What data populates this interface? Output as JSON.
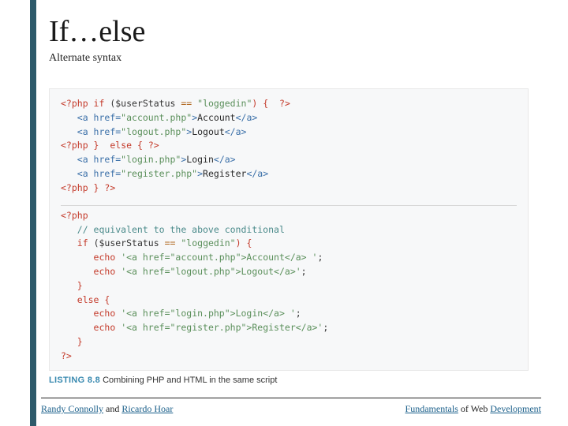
{
  "title": "If…else",
  "subtitle": "Alternate syntax",
  "code": {
    "block1": {
      "l1_a": "<?php ",
      "l1_b": "if",
      "l1_c": " ($userStatus ",
      "l1_d": "==",
      "l1_e": " ",
      "l1_f": "\"loggedin\"",
      "l1_g": ") { ",
      "l1_h": " ?>",
      "l2_a": "   ",
      "l2_b": "<a href=",
      "l2_c": "\"account.php\"",
      "l2_d": ">",
      "l2_e": "Account",
      "l2_f": "</a>",
      "l3_a": "   ",
      "l3_b": "<a href=",
      "l3_c": "\"logout.php\"",
      "l3_d": ">",
      "l3_e": "Logout",
      "l3_f": "</a>",
      "l4_a": "<?php ",
      "l4_b": "}",
      "l4_c": "  ",
      "l4_d": "else",
      "l4_e": " { ",
      "l4_f": "?>",
      "l5_a": "   ",
      "l5_b": "<a href=",
      "l5_c": "\"login.php\"",
      "l5_d": ">",
      "l5_e": "Login",
      "l5_f": "</a>",
      "l6_a": "   ",
      "l6_b": "<a href=",
      "l6_c": "\"register.php\"",
      "l6_d": ">",
      "l6_e": "Register",
      "l6_f": "</a>",
      "l7_a": "<?php ",
      "l7_b": "}",
      "l7_c": " ?>"
    },
    "block2": {
      "l1": "<?php",
      "l2": "   // equivalent to the above conditional",
      "l3_a": "   ",
      "l3_b": "if",
      "l3_c": " ($userStatus ",
      "l3_d": "==",
      "l3_e": " ",
      "l3_f": "\"loggedin\"",
      "l3_g": ") {",
      "l4_a": "      ",
      "l4_b": "echo",
      "l4_c": " ",
      "l4_d": "'<a href=\"account.php\">Account</a> '",
      "l4_e": ";",
      "l5_a": "      ",
      "l5_b": "echo",
      "l5_c": " ",
      "l5_d": "'<a href=\"logout.php\">Logout</a>'",
      "l5_e": ";",
      "l6": "   }",
      "l7_a": "   ",
      "l7_b": "else",
      "l7_c": " {",
      "l8_a": "      ",
      "l8_b": "echo",
      "l8_c": " ",
      "l8_d": "'<a href=\"login.php\">Login</a> '",
      "l8_e": ";",
      "l9_a": "      ",
      "l9_b": "echo",
      "l9_c": " ",
      "l9_d": "'<a href=\"register.php\">Register</a>'",
      "l9_e": ";",
      "l10": "   }",
      "l11": "?>"
    }
  },
  "caption": {
    "num": "LISTING 8.8",
    "text": " Combining PHP and HTML in the same script"
  },
  "footer": {
    "author1": "Randy Connolly",
    "and": " and ",
    "author2": "Ricardo Hoar",
    "book_u1": "Fundamentals",
    "book_mid": " of Web ",
    "book_u2": "Development"
  }
}
